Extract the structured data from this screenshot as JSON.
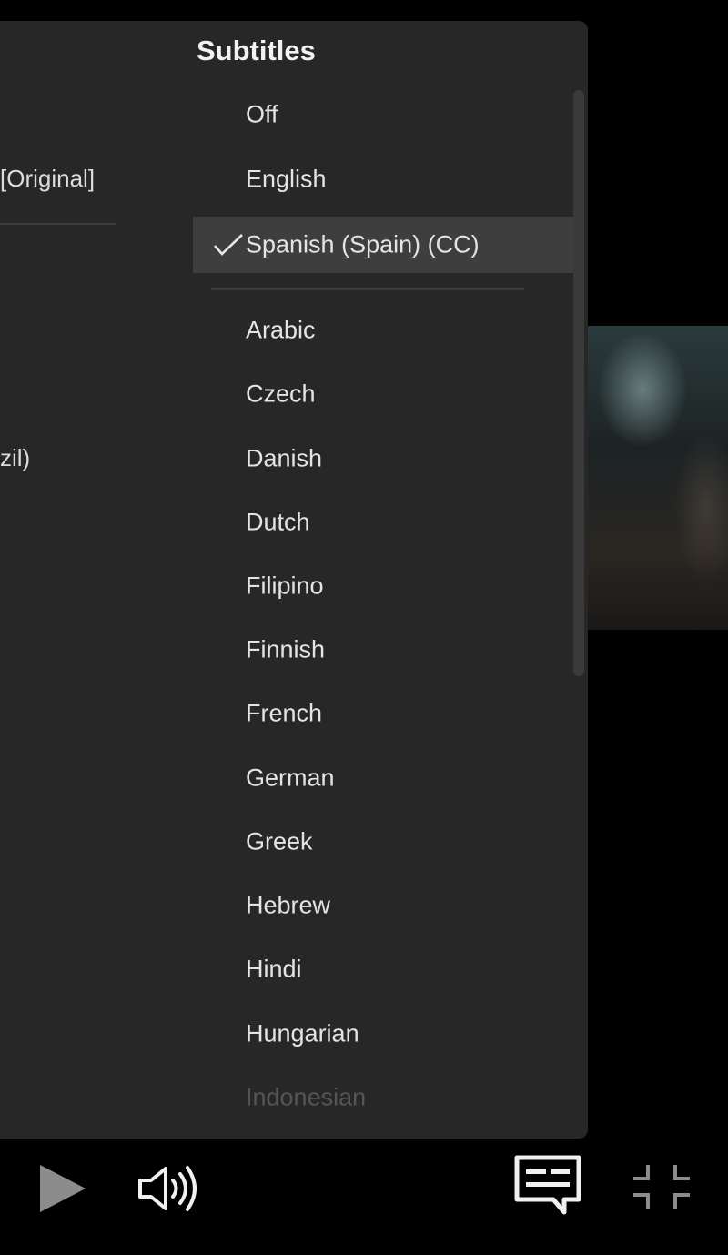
{
  "background_menu": {
    "audio_track_value": "[Original]",
    "language_fragment": "zil)"
  },
  "subtitles_panel": {
    "title": "Subtitles",
    "selected_index": 2,
    "items": [
      {
        "label": "Off"
      },
      {
        "label": "English"
      },
      {
        "label": "Spanish (Spain) (CC)"
      },
      {
        "label": "Arabic"
      },
      {
        "label": "Czech"
      },
      {
        "label": "Danish"
      },
      {
        "label": "Dutch"
      },
      {
        "label": "Filipino"
      },
      {
        "label": "Finnish"
      },
      {
        "label": "French"
      },
      {
        "label": "German"
      },
      {
        "label": "Greek"
      },
      {
        "label": "Hebrew"
      },
      {
        "label": "Hindi"
      },
      {
        "label": "Hungarian"
      },
      {
        "label": "Indonesian"
      }
    ]
  },
  "controls": {
    "icons": [
      "play-icon",
      "volume-icon",
      "subtitles-icon",
      "exit-fullscreen-icon"
    ]
  },
  "colors": {
    "panel": "#272727",
    "selected_row": "#3e3e3e",
    "text": "#e4e4e4"
  }
}
